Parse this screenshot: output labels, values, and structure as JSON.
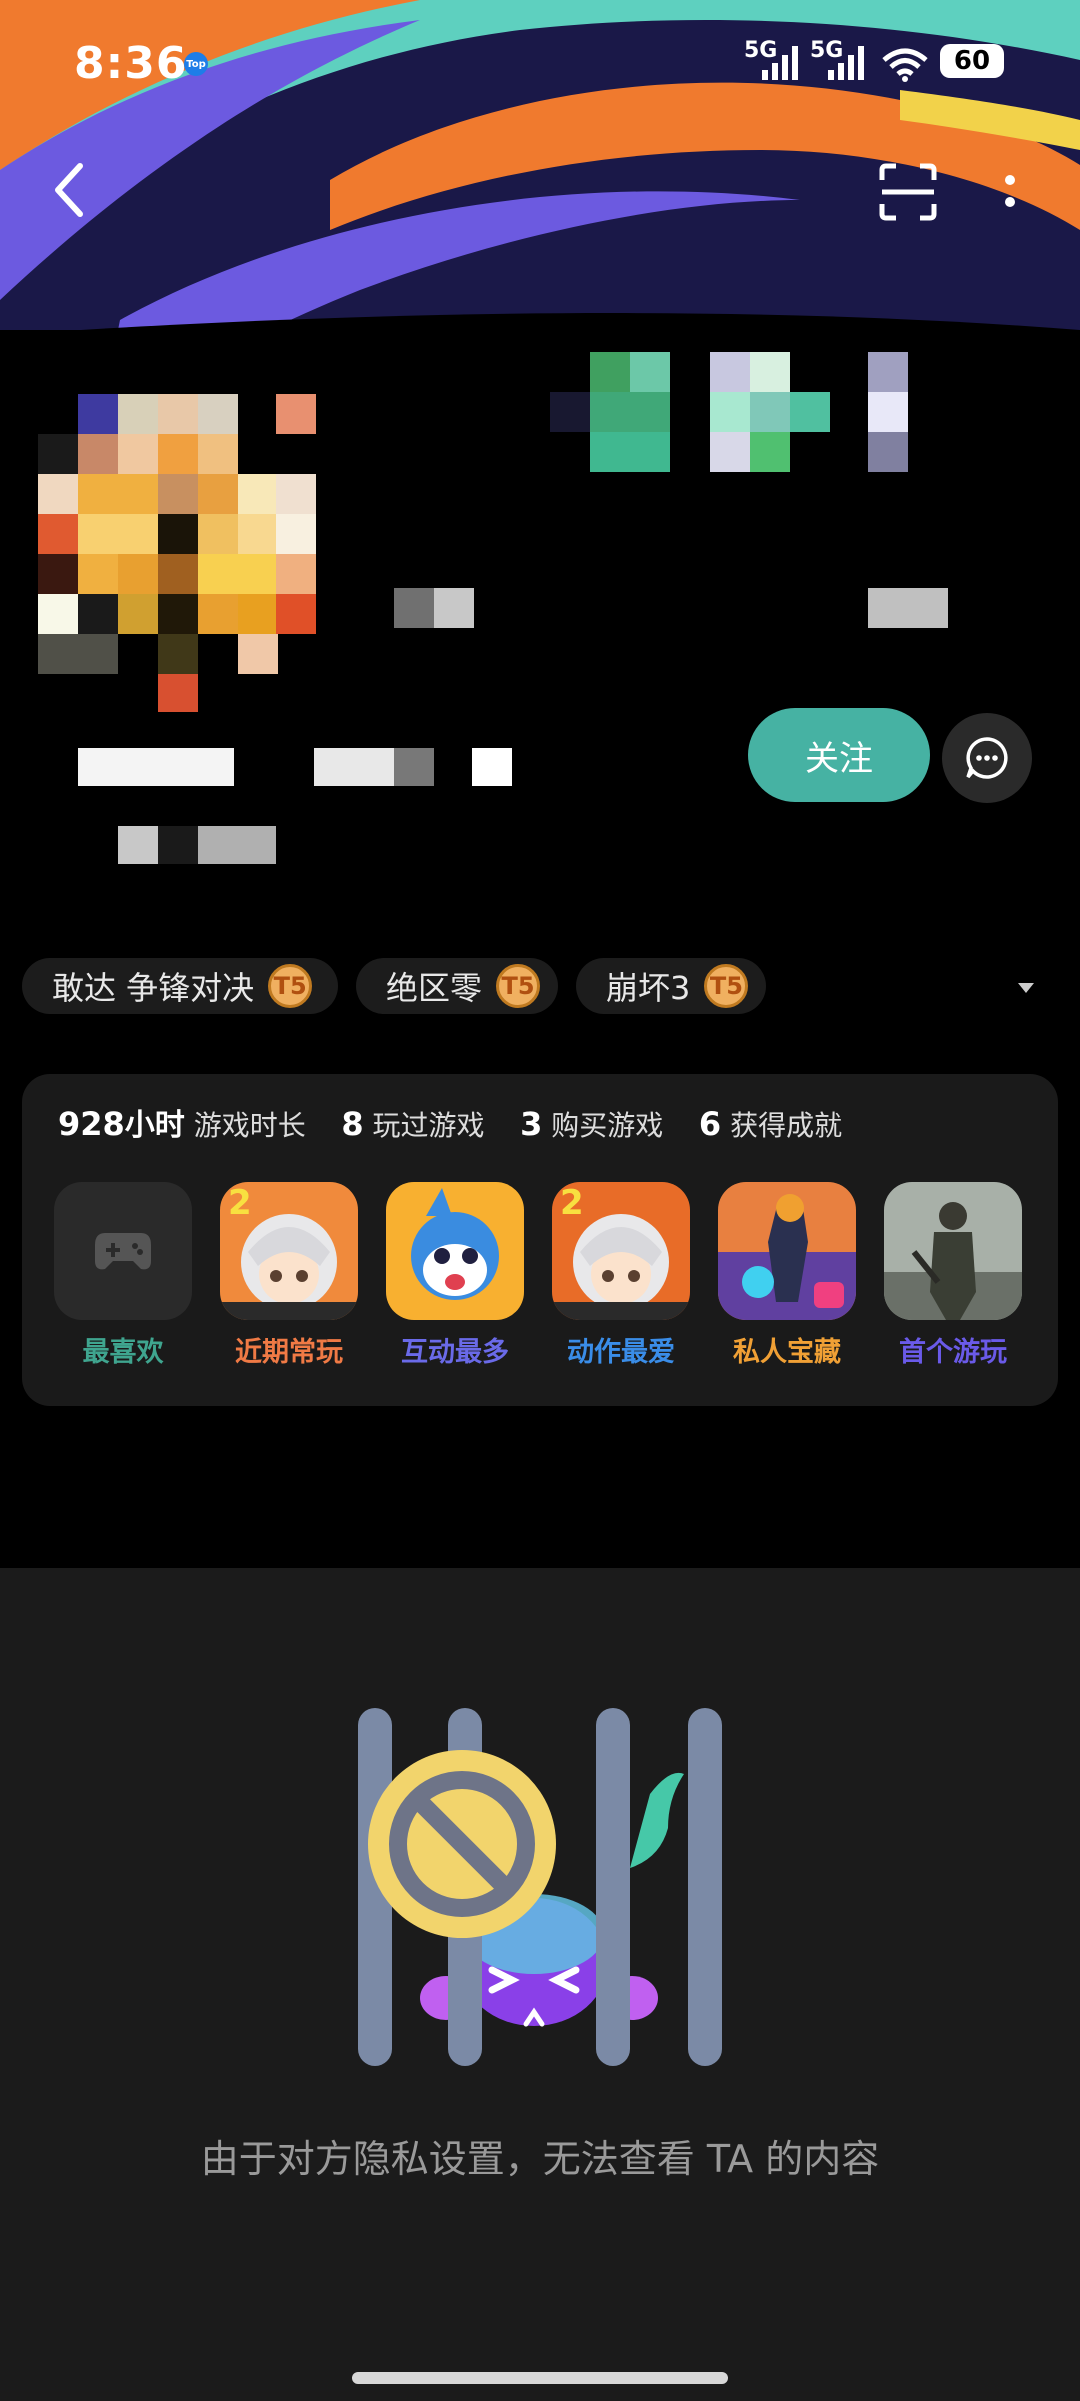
{
  "status_bar": {
    "time": "8:36",
    "top_badge": "Top",
    "signal1": "5G",
    "signal2": "5G",
    "battery": "60"
  },
  "header": {
    "back_icon": "chevron-left-icon",
    "scan_icon": "scan-icon",
    "more_icon": "more-vertical-icon"
  },
  "profile": {
    "follow_label": "关注",
    "chat_icon": "chat-bubble-icon"
  },
  "tags": [
    {
      "label": "敢达 争锋对决",
      "badge": "T5"
    },
    {
      "label": "绝区零",
      "badge": "T5"
    },
    {
      "label": "崩坏3",
      "badge": "T5"
    }
  ],
  "stats": {
    "hours_value": "928",
    "hours_unit": "小时",
    "hours_label": "游戏时长",
    "played_value": "8",
    "played_label": "玩过游戏",
    "bought_value": "3",
    "bought_label": "购买游戏",
    "achievements_value": "6",
    "achievements_label": "获得成就"
  },
  "games": [
    {
      "label": "最喜欢",
      "color": "#3fa58f",
      "bg": "#1e3a35",
      "icon": "gamepad-icon"
    },
    {
      "label": "近期常玩",
      "color": "#f07a45",
      "bg": "#3a2418",
      "icon": "anime-character-icon"
    },
    {
      "label": "互动最多",
      "color": "#6a6ae8",
      "bg": "#24243e",
      "icon": "blue-mascot-icon"
    },
    {
      "label": "动作最爱",
      "color": "#3a8de8",
      "bg": "#1a2a3e",
      "icon": "anime-character-icon"
    },
    {
      "label": "私人宝藏",
      "color": "#f0a035",
      "bg": "#3a2c14",
      "icon": "warrior-icon"
    },
    {
      "label": "首个游玩",
      "color": "#6a5ae8",
      "bg": "#24203e",
      "icon": "survivor-icon"
    }
  ],
  "privacy_message": "由于对方隐私设置，无法查看 TA 的内容",
  "colors": {
    "accent_teal": "#46b2a3",
    "card_bg": "#1a1a1a",
    "lower_bg": "#1b1b1b"
  }
}
